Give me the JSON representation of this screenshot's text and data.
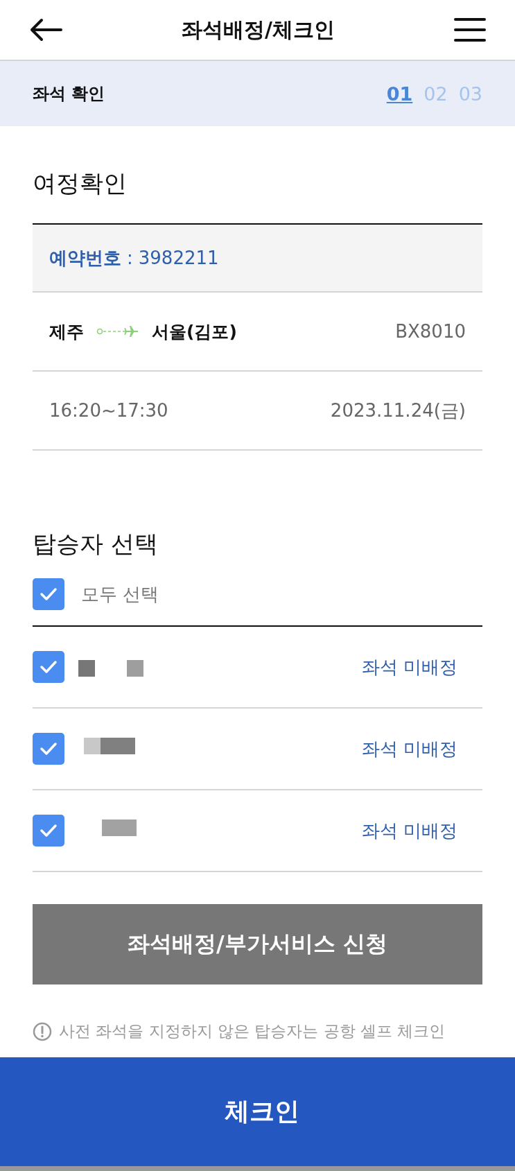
{
  "header": {
    "title": "좌석배정/체크인"
  },
  "step_bar": {
    "label": "좌석 확인",
    "steps": [
      {
        "label": "01",
        "selected": true
      },
      {
        "label": "02",
        "selected": false
      },
      {
        "label": "03",
        "selected": false
      }
    ]
  },
  "itinerary": {
    "heading": "여정확인",
    "booking_label": "예약번호",
    "booking_separator": ":",
    "booking_number": "3982211",
    "origin": "제주",
    "destination": "서울(김포)",
    "flight": "BX8010",
    "time": "16:20~17:30",
    "date": "2023.11.24(금)"
  },
  "passengers": {
    "heading": "탑승자 선택",
    "select_all": {
      "label": "모두 선택",
      "checked": true
    },
    "rows": [
      {
        "checked": true,
        "seat_status": "좌석 미배정"
      },
      {
        "checked": true,
        "seat_status": "좌석 미배정"
      },
      {
        "checked": true,
        "seat_status": "좌석 미배정"
      }
    ]
  },
  "seat_button": "좌석배정/부가서비스 신청",
  "notice": "사전 좌석을 지정하지 않은 탑승자는 공항 셀프 체크인",
  "checkin_button": "체크인"
}
